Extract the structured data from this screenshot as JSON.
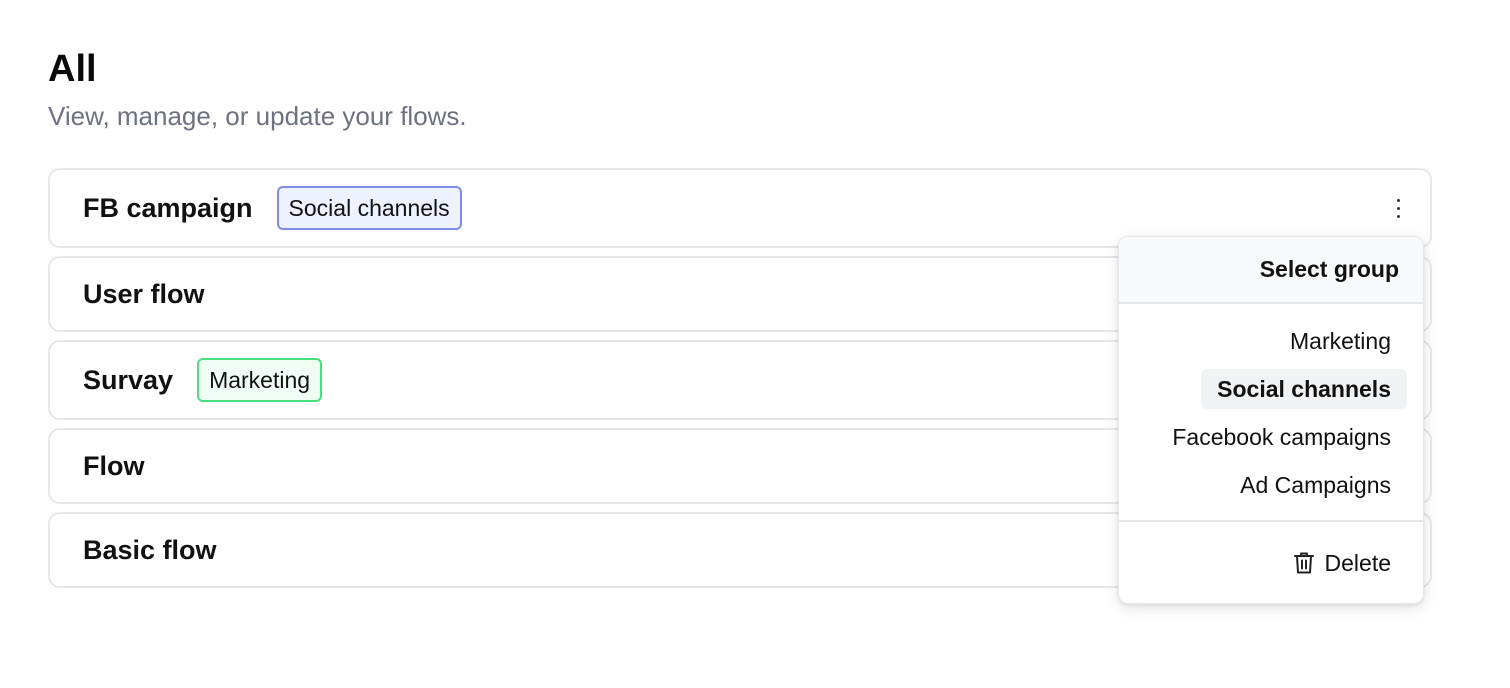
{
  "header": {
    "title": "All",
    "subtitle": "View, manage, or update your flows."
  },
  "flows": [
    {
      "name": "FB campaign",
      "tag": "Social channels",
      "tag_color": "#7c8ce8"
    },
    {
      "name": "User flow",
      "tag": ""
    },
    {
      "name": "Survay",
      "tag": "Marketing",
      "tag_color": "#4ade80"
    },
    {
      "name": "Flow",
      "tag": ""
    },
    {
      "name": "Basic flow",
      "tag": ""
    }
  ],
  "group_menu": {
    "title": "Select group",
    "options": [
      {
        "label": "Marketing",
        "selected": false
      },
      {
        "label": "Social channels",
        "selected": true
      },
      {
        "label": "Facebook campaigns",
        "selected": false
      },
      {
        "label": "Ad Campaigns",
        "selected": false
      }
    ],
    "delete_label": "Delete",
    "delete_icon": "trash-icon"
  },
  "colors": {
    "social_tag_border": "#7c8ce8",
    "social_tag_bg": "#eef1ff",
    "marketing_tag_border": "#4ade80",
    "marketing_tag_bg": "#f0fdf4",
    "subtitle": "#6b7280"
  }
}
